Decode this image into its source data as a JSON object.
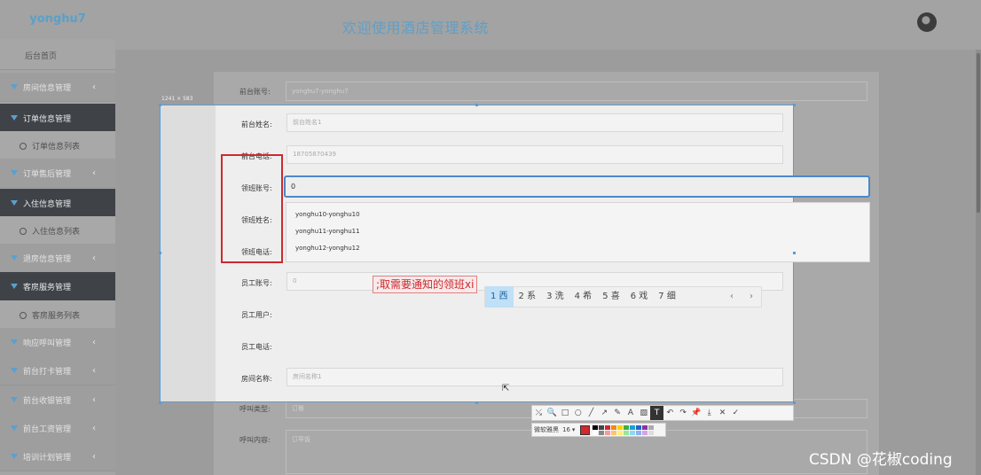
{
  "header": {
    "brand": "yonghu7",
    "title": "欢迎使用酒店管理系统"
  },
  "sidebar": {
    "items": [
      {
        "label": "后台首页",
        "kind": "home"
      },
      {
        "label": "房间信息管理",
        "kind": "group"
      },
      {
        "label": "订单信息管理",
        "kind": "open"
      },
      {
        "label": "订单信息列表",
        "kind": "sub"
      },
      {
        "label": "订单售后管理",
        "kind": "group"
      },
      {
        "label": "入住信息管理",
        "kind": "open"
      },
      {
        "label": "入住信息列表",
        "kind": "sub"
      },
      {
        "label": "退房信息管理",
        "kind": "group"
      },
      {
        "label": "客房服务管理",
        "kind": "open"
      },
      {
        "label": "客房服务列表",
        "kind": "sub"
      },
      {
        "label": "响应呼叫管理",
        "kind": "group"
      },
      {
        "label": "前台打卡管理",
        "kind": "group"
      },
      {
        "label": "前台收银管理",
        "kind": "group"
      },
      {
        "label": "前台工资管理",
        "kind": "group"
      },
      {
        "label": "培训计划管理",
        "kind": "group"
      }
    ],
    "arrow": "‹"
  },
  "form": {
    "rows": [
      {
        "label": "前台账号:",
        "value": "yonghu7-yonghu7"
      },
      {
        "label": "前台姓名:",
        "value": "前台姓名1"
      },
      {
        "label": "前台电话:",
        "value": "18705870439"
      },
      {
        "label": "领班账号:",
        "value": "0"
      },
      {
        "label": "领班姓名:",
        "value": ""
      },
      {
        "label": "领班电话:",
        "value": ""
      },
      {
        "label": "员工账号:",
        "value": "0"
      },
      {
        "label": "员工用户:",
        "value": ""
      },
      {
        "label": "员工电话:",
        "value": ""
      },
      {
        "label": "房间名称:",
        "value": "房间名称1"
      },
      {
        "label": "呼叫类型:",
        "value": "订餐"
      },
      {
        "label": "呼叫内容:",
        "value": "订早饭"
      }
    ],
    "dropdown": [
      "yonghu10-yonghu10",
      "yonghu11-yonghu11",
      "yonghu12-yonghu12"
    ]
  },
  "snip": {
    "size_label": "1241 × 583",
    "note": ";取需要通知的领班xi",
    "ime_candidates": [
      "1 西",
      "2 系",
      "3 洗",
      "4 希",
      "5 喜",
      "6 戏",
      "7 细"
    ],
    "ime_prev": "‹",
    "ime_next": "›",
    "tools": [
      "⤯",
      "🔍",
      "□",
      "○",
      "╱",
      "↗",
      "✎",
      "A",
      "▨",
      "T",
      "↶",
      "↷",
      "📌",
      "⤓",
      "✕",
      "✓"
    ],
    "font_name": "微软雅黑",
    "font_size": "16",
    "font_caret": "▾",
    "current_color": "#d0282e",
    "palette": [
      "#000000",
      "#444444",
      "#d0282e",
      "#f08b00",
      "#f5d500",
      "#3cb043",
      "#1aa0d8",
      "#2266cc",
      "#8833aa",
      "#aaaaaa",
      "#ffffff",
      "#888888",
      "#f59aa0",
      "#ffc46b",
      "#fff176",
      "#9be59b",
      "#8fd8f5",
      "#8fb2f0",
      "#d3a3e8",
      "#dddddd"
    ]
  },
  "watermark": "CSDN @花椒coding"
}
